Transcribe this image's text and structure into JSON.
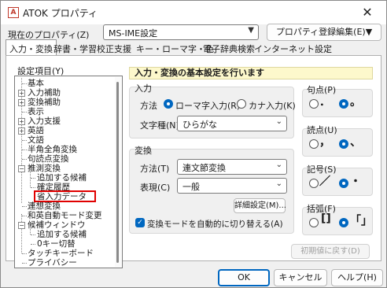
{
  "window": {
    "title": "ATOK プロパティ",
    "icon_text": "A",
    "close_glyph": "✕"
  },
  "profile": {
    "label": "現在のプロパティ(Z)",
    "value": "MS-IME設定",
    "edit_button": "プロパティ登録編集(E)▼"
  },
  "tabs": [
    {
      "label": "入力・変換",
      "active": true
    },
    {
      "label": "辞書・学習"
    },
    {
      "label": "校正支援"
    },
    {
      "label": "キー・ローマ字・色"
    },
    {
      "label": "電子辞典検索"
    },
    {
      "label": "インターネット設定"
    }
  ],
  "tree": {
    "label": "設定項目(Y)",
    "items": [
      {
        "label": "基本"
      },
      {
        "label": "入力補助",
        "expander": "+"
      },
      {
        "label": "変換補助",
        "expander": "+"
      },
      {
        "label": "表示"
      },
      {
        "label": "入力支援",
        "expander": "+"
      },
      {
        "label": "英語",
        "expander": "+"
      },
      {
        "label": "文語"
      },
      {
        "label": "半角全角変換"
      },
      {
        "label": "句読点変換"
      },
      {
        "label": "推測変換",
        "expander": "−"
      },
      {
        "label": "追加する候補"
      },
      {
        "label": "確定履歴"
      },
      {
        "label": "省入力データ"
      },
      {
        "label": "連想変換"
      },
      {
        "label": "和英自動モード変更"
      },
      {
        "label": "候補ウィンドウ",
        "expander": "−"
      },
      {
        "label": "追加する候補"
      },
      {
        "label": "0キー切替"
      },
      {
        "label": "タッチキーボード"
      },
      {
        "label": "プライバシー"
      }
    ]
  },
  "panel": {
    "header": "入力・変換の基本設定を行います",
    "input_group": {
      "title": "入力",
      "method_label": "方法",
      "method_options": [
        "ローマ字入力(R)",
        "カナ入力(K)"
      ],
      "method_selected": 0,
      "charset_label": "文字種(N)",
      "charset_value": "ひらがな"
    },
    "conversion_group": {
      "title": "変換",
      "method_label": "方法(T)",
      "method_value": "連文節変換",
      "display_label": "表現(C)",
      "display_value": "一般",
      "detail_button": "詳細設定(M)...",
      "auto_switch_label": "変換モードを自動的に切り替える(A)",
      "auto_switch_checked": true
    },
    "punct_group": {
      "title": "句点(P)",
      "options": [
        "．",
        "。"
      ],
      "selected": 1
    },
    "comma_group": {
      "title": "読点(U)",
      "options": [
        "，",
        "、"
      ],
      "selected": 1
    },
    "symbol_group": {
      "title": "記号(S)",
      "options": [
        "／",
        "・"
      ],
      "selected": 1
    },
    "bracket_group": {
      "title": "括弧(F)",
      "options": [
        "[]",
        "「」"
      ],
      "selected": 1
    },
    "reset_button": "初期値に戻す(D)"
  },
  "footer": {
    "ok": "OK",
    "cancel": "キャンセル",
    "help": "ヘルプ(H)"
  },
  "colors": {
    "accent": "#0067c0",
    "highlight": "#e00000",
    "header_bg": "#fdf8cc"
  }
}
